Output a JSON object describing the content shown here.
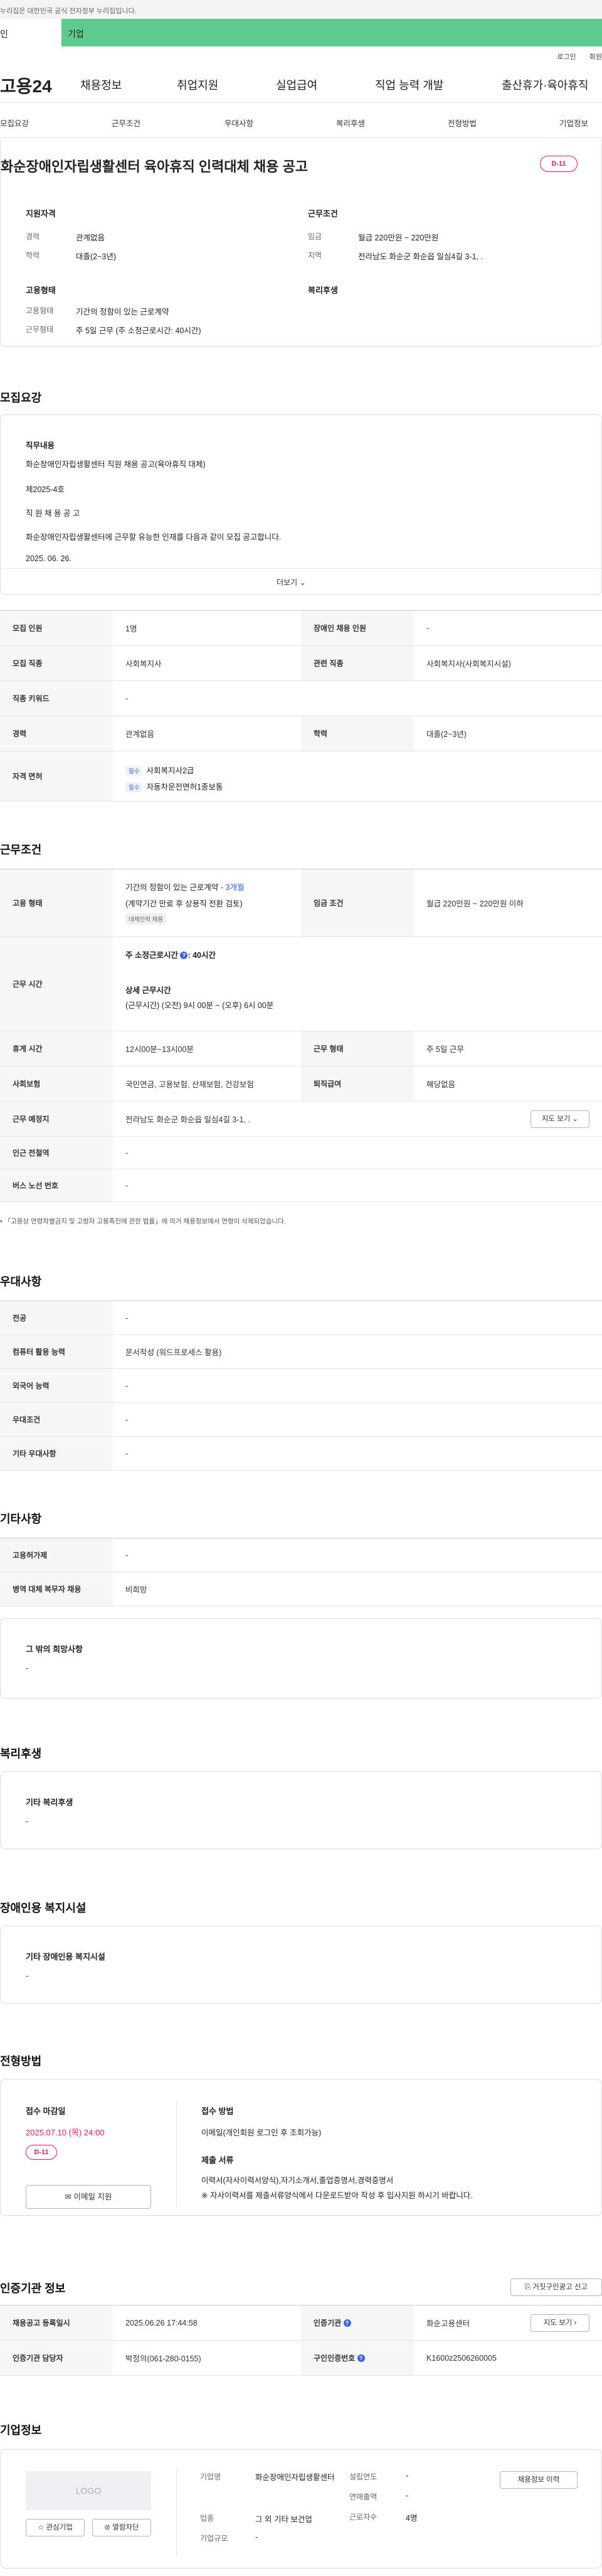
{
  "topbar": {
    "notice": "누리집은 대한민국 공식 전자정부 누리집입니다."
  },
  "segment": {
    "personal": "인",
    "company": "기업"
  },
  "util": {
    "login": "로그인",
    "join": "회원"
  },
  "gnb": {
    "logo": "고용24",
    "menu": [
      "채용정보",
      "취업지원",
      "실업급여",
      "직업 능력 개발",
      "출산휴가·육아휴직"
    ]
  },
  "lnb": {
    "tabs": [
      "모집요강",
      "근무조건",
      "우대사항",
      "복리후생",
      "전형방법",
      "기업정보"
    ]
  },
  "summary": {
    "title": "화순장애인자립생활센터 육아휴직 인력대체 채용 공고",
    "dday": "D-11",
    "qual_title": "지원자격",
    "qual": [
      {
        "label": "경력",
        "value": "관계없음"
      },
      {
        "label": "학력",
        "value": "대졸(2~3년)"
      }
    ],
    "cond_title": "근무조건",
    "cond": [
      {
        "label": "임금",
        "value": "월급 220만원 ~ 220만원"
      },
      {
        "label": "지역",
        "value": "전라남도 화순군 화순읍 일심4길 3-1, ."
      }
    ],
    "emp_title": "고용형태",
    "emp": [
      {
        "label": "고용형태",
        "value": "기간의 정함이 있는 근로계약"
      },
      {
        "label": "근무형태",
        "value": "주 5일 근무 (주 소정근로시간: 40시간)"
      }
    ],
    "welfare_title": "복리후생"
  },
  "recruit": {
    "heading": "모집요강",
    "duty_label": "직무내용",
    "lines": [
      "화순장애인자립생활센터 직원 채용 공고(육아휴직 대체)",
      "제2025-4호",
      "직 원 채 용 공 고",
      "화순장애인자립생활센터에 근무할 유능한 인재를 다음과 같이 모집 공고합니다.",
      "2025. 06. 26."
    ],
    "more": "더보기",
    "table": [
      {
        "l1": "모집 인원",
        "v1": "1명",
        "l2": "장애인 채용 인원",
        "v2": "-"
      },
      {
        "l1": "모집 직종",
        "v1": "사회복지사",
        "l2": "관련 직종",
        "v2": "사회복지사(사회복지시설)"
      },
      {
        "l1": "직종 키워드",
        "v1": "-"
      },
      {
        "l1": "경력",
        "v1": "관계없음",
        "l2": "학력",
        "v2": "대졸(2~3년)"
      }
    ],
    "license_label": "자격 면허",
    "licenses": [
      {
        "chip": "필수",
        "name": "사회복지사2급"
      },
      {
        "chip": "필수",
        "name": "자동차운전면허1종보통"
      }
    ]
  },
  "work": {
    "heading": "근무조건",
    "emp_type_label": "고용 형태",
    "emp_type_l1": "기간의 정함이 있는 근로계약 - ",
    "emp_type_months": "3개월",
    "emp_type_l2": "(계약기간 만료 후 상용직 전환 검토)",
    "emp_type_tag": "대체인력 채용",
    "wage_label": "임금 조건",
    "wage": "월급 220만원 ~ 220만원 이하",
    "hours_label": "근무 시간",
    "hours_main_prefix": "주 소정근로시간",
    "hours_main_value": ": 40시간",
    "hours_detail_title": "상세 근무시간",
    "hours_detail": "(근무시간) (오전) 9시 00분 ~ (오후) 6시 00분",
    "rows": [
      {
        "l1": "휴게 시간",
        "v1": "12시00분~13시00분",
        "l2": "근무 형태",
        "v2": "주 5일 근무"
      },
      {
        "l1": "사회보험",
        "v1": "국민연금, 고용보험, 산재보험, 건강보험",
        "l2": "퇴직급여",
        "v2": "해당없음"
      }
    ],
    "place_label": "근무 예정지",
    "place": "전라남도 화순군 화순읍 일심4길 3-1, .",
    "map_btn": "지도 보기",
    "rest": [
      {
        "l": "인근 전철역",
        "v": "-"
      },
      {
        "l": "버스 노선 번호",
        "v": "-"
      }
    ],
    "note": "「고용상 연령차별금지 및 고령자 고용촉진에 관한 법률」에 의거 채용정보에서 연령이 삭제되었습니다."
  },
  "pref": {
    "heading": "우대사항",
    "rows": [
      {
        "l": "전공",
        "v": "-"
      },
      {
        "l": "컴퓨터 활용 능력",
        "v": "문서작성 (워드프로세스 활용)"
      },
      {
        "l": "외국어 능력",
        "v": "-"
      },
      {
        "l": "우대조건",
        "v": "-"
      },
      {
        "l": "기타 우대사항",
        "v": "-"
      }
    ]
  },
  "etc": {
    "heading": "기타사항",
    "rows": [
      {
        "l": "고용허가제",
        "v": "-"
      },
      {
        "l": "병역 대체 복무자 채용",
        "v": "비희망"
      }
    ],
    "wish_title": "그 밖의 희망사항",
    "wish": "-"
  },
  "welfare": {
    "heading": "복리후생",
    "title": "기타 복리후생",
    "value": "-"
  },
  "disabled": {
    "heading": "장애인용 복지시설",
    "title": "기타 장애인용 복지시설",
    "value": "-"
  },
  "selection": {
    "heading": "전형방법",
    "deadline_title": "접수 마감일",
    "deadline": "2025.07.10 (목) 24:00",
    "dday": "D-11",
    "apply_btn": "이메일 지원",
    "method_title": "접수 방법",
    "method": "이메일(개인회원 로그인 후 조회가능)",
    "docs_title": "제출 서류",
    "docs": "이력서(자사이력서양식),자기소개서,졸업증명서,경력증명서",
    "docs_note": "※ 자사이력서를 제출서류양식에서 다운로드받아 작성 후 입사지원 하시기 바랍니다."
  },
  "cert": {
    "heading": "인증기관 정보",
    "report_btn": "거짓구인광고 신고",
    "rows": [
      {
        "l1": "채용공고 등록일시",
        "v1": "2025.06.26 17:44:58",
        "l2": "인증기관",
        "v2": "화순고용센터",
        "btn": "지도 보기"
      },
      {
        "l1": "인증기관 담당자",
        "v1": "박정의(061-280-0155)",
        "l2": "구인인증번호",
        "v2": "K1600z2506260005"
      }
    ]
  },
  "company": {
    "heading": "기업정보",
    "logo": "LOGO",
    "fav_btn": "관심기업",
    "block_btn": "열람차단",
    "fields": [
      {
        "l": "기업명",
        "v": "화순장애인자립생활센터"
      },
      {
        "l": "업종",
        "v": "그 외 기타 보건업"
      },
      {
        "l": "기업규모",
        "v": "-"
      }
    ],
    "fields2": [
      {
        "l": "설립연도",
        "v": "-"
      },
      {
        "l": "연매출액",
        "v": "-"
      },
      {
        "l": "근로자수",
        "v": "4명"
      }
    ],
    "history_btn": "채용정보 이력"
  }
}
